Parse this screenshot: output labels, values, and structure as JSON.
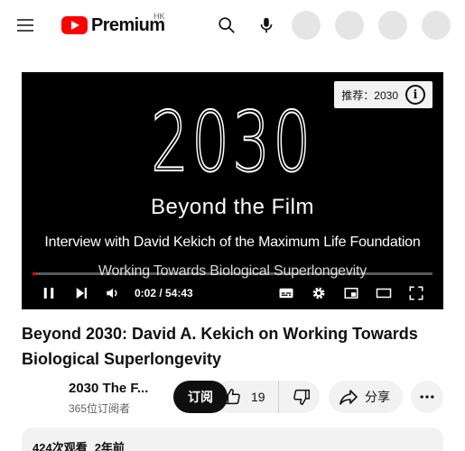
{
  "header": {
    "logo_text": "Premium",
    "region": "HK"
  },
  "player": {
    "overlay": {
      "title_big": "2030",
      "subtitle": "Beyond the Film",
      "line1": "Interview with David Kekich of the Maximum Life Foundation",
      "line2": "Working Towards Biological Superlongevity"
    },
    "recommend_chip": "推荐：2030",
    "time_display": "0:02 / 54:43",
    "progress_fraction": 0.0006
  },
  "video": {
    "title": "Beyond 2030: David A. Kekich on Working Towards Biological Superlongevity"
  },
  "channel": {
    "name": "2030 The F...",
    "subscribers": "365位订阅者",
    "subscribe_label": "订阅"
  },
  "actions": {
    "like_count": "19",
    "share_label": "分享"
  },
  "description": {
    "views": "424次观看",
    "age": "2年前"
  },
  "colors": {
    "brand_red": "#ff0000",
    "pill_bg": "#f2f2f2",
    "text": "#0f0f0f"
  }
}
